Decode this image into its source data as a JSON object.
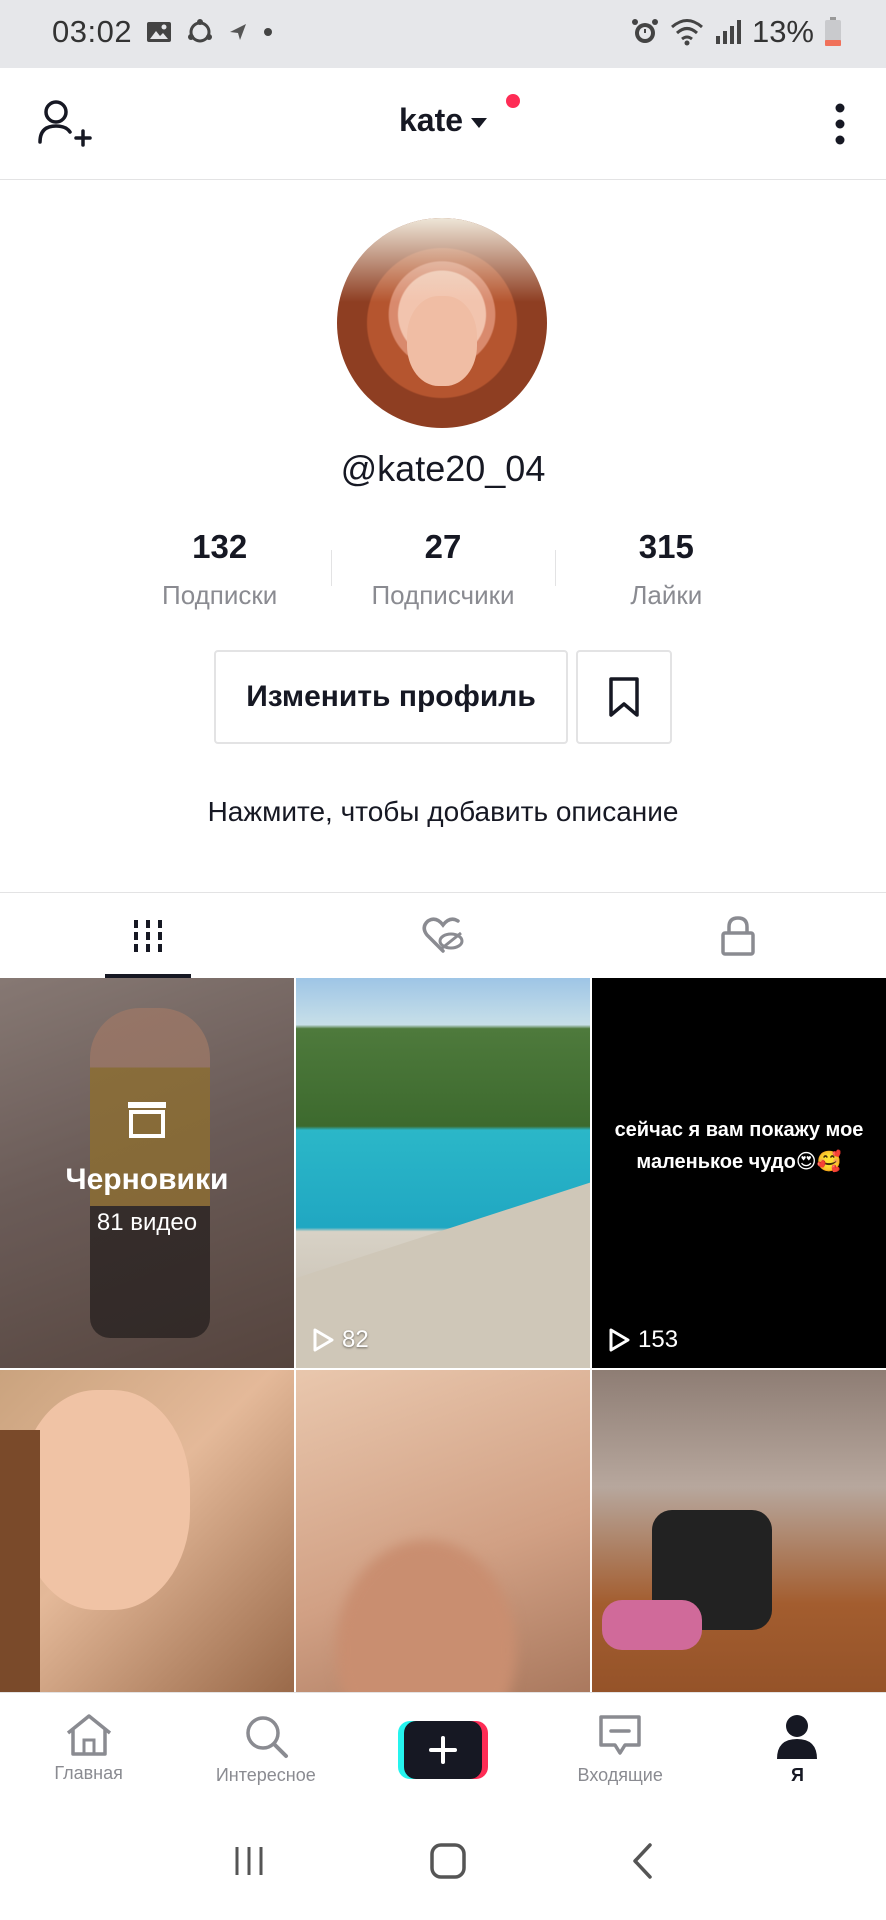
{
  "status_bar": {
    "time": "03:02",
    "battery": "13%",
    "icons_left": [
      "image-icon",
      "sync-icon",
      "signal-arrow-icon",
      "dot-icon"
    ],
    "icons_right": [
      "alarm-icon",
      "wifi-icon",
      "cell-signal-icon",
      "battery-icon"
    ]
  },
  "header": {
    "title": "kate",
    "notification_color": "#fe2c55"
  },
  "profile": {
    "username": "@kate20_04",
    "stats": [
      {
        "value": "132",
        "label": "Подписки"
      },
      {
        "value": "27",
        "label": "Подписчики"
      },
      {
        "value": "315",
        "label": "Лайки"
      }
    ],
    "edit_button": "Изменить профиль",
    "bio_prompt": "Нажмите, чтобы добавить описание"
  },
  "tabs": [
    {
      "icon": "grid-icon",
      "active": true
    },
    {
      "icon": "liked-hidden-icon",
      "active": false
    },
    {
      "icon": "lock-icon",
      "active": false
    }
  ],
  "videos": [
    {
      "type": "drafts",
      "title": "Черновики",
      "subtitle": "81 видео"
    },
    {
      "type": "video",
      "views": "82"
    },
    {
      "type": "video",
      "views": "153",
      "caption": "сейчас я вам покажу мое маленькое чудо😍🥰"
    },
    {
      "type": "video"
    },
    {
      "type": "video"
    },
    {
      "type": "video"
    }
  ],
  "bottom_nav": [
    {
      "label": "Главная",
      "icon": "home-icon"
    },
    {
      "label": "Интересное",
      "icon": "search-icon"
    },
    {
      "label": "",
      "icon": "plus-icon"
    },
    {
      "label": "Входящие",
      "icon": "inbox-icon"
    },
    {
      "label": "Я",
      "icon": "profile-icon",
      "active": true
    }
  ],
  "colors": {
    "accent": "#fe2c55",
    "accent_cyan": "#25f4ee",
    "text_primary": "#161823",
    "text_secondary": "#8a8b91"
  }
}
